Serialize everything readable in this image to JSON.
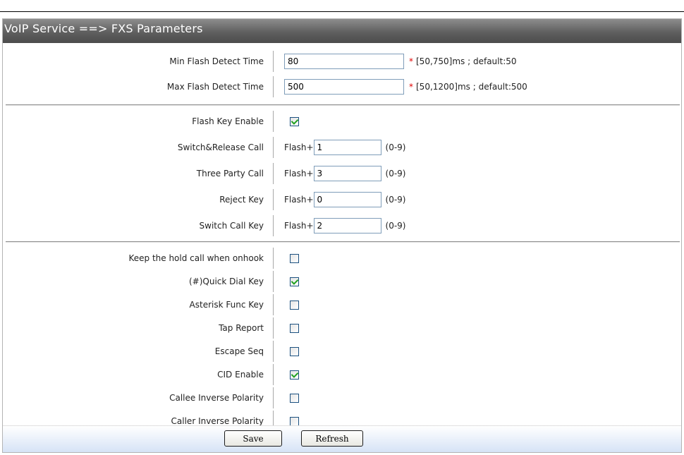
{
  "title": "VoIP Service ==> FXS Parameters",
  "flash_detect": {
    "min": {
      "label": "Min Flash Detect Time",
      "value": "80",
      "required": "*",
      "hint": "[50,750]ms ; default:50"
    },
    "max": {
      "label": "Max Flash Detect Time",
      "value": "500",
      "required": "*",
      "hint": "[50,1200]ms ; default:500"
    }
  },
  "flash_keys": {
    "enable": {
      "label": "Flash Key Enable",
      "checked": true
    },
    "prefix": "Flash+",
    "range": "(0-9)",
    "items": [
      {
        "label": "Switch&Release Call",
        "value": "1"
      },
      {
        "label": "Three Party Call",
        "value": "3"
      },
      {
        "label": "Reject Key",
        "value": "0"
      },
      {
        "label": "Switch Call Key",
        "value": "2"
      }
    ]
  },
  "options": [
    {
      "label": "Keep the hold call when onhook",
      "checked": false
    },
    {
      "label": "(#)Quick Dial Key",
      "checked": true
    },
    {
      "label": "Asterisk Func Key",
      "checked": false
    },
    {
      "label": "Tap Report",
      "checked": false
    },
    {
      "label": "Escape Seq",
      "checked": false
    },
    {
      "label": "CID Enable",
      "checked": true
    },
    {
      "label": "Callee Inverse Polarity",
      "checked": false
    },
    {
      "label": "Caller Inverse Polarity",
      "checked": false
    }
  ],
  "buttons": {
    "save": "Save",
    "refresh": "Refresh"
  },
  "colors": {
    "title_bar": "#5f5f5f",
    "required_star": "#e00000",
    "check_mark": "#21a121",
    "footer": "#d6e3f6"
  }
}
